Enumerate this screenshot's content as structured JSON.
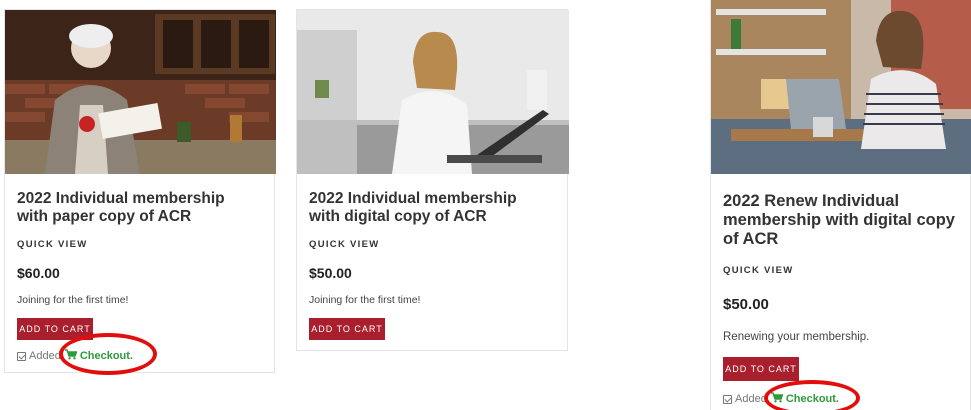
{
  "products": [
    {
      "title": "2022 Individual membership with paper copy of ACR",
      "quick_view": "QUICK VIEW",
      "price": "$60.00",
      "description": "Joining for the first time!",
      "add_to_cart": "ADD TO CART",
      "added_label": "Added",
      "checkout_label": "Checkout."
    },
    {
      "title": "2022 Individual membership with digital copy of ACR",
      "quick_view": "QUICK VIEW",
      "price": "$50.00",
      "description": "Joining for the first time!",
      "add_to_cart": "ADD TO CART"
    },
    {
      "title": "2022 Renew Individual membership with digital copy of ACR",
      "quick_view": "QUICK VIEW",
      "price": "$50.00",
      "description": "Renewing your membership.",
      "add_to_cart": "ADD TO CART",
      "added_label": "Added",
      "checkout_label": "Checkout."
    }
  ],
  "colors": {
    "add_to_cart_bg": "#a91f2e",
    "checkout_text": "#2e9a3e",
    "annotation_ring": "#e20d0d"
  },
  "icons": [
    "cart-icon",
    "checkbox-icon"
  ]
}
